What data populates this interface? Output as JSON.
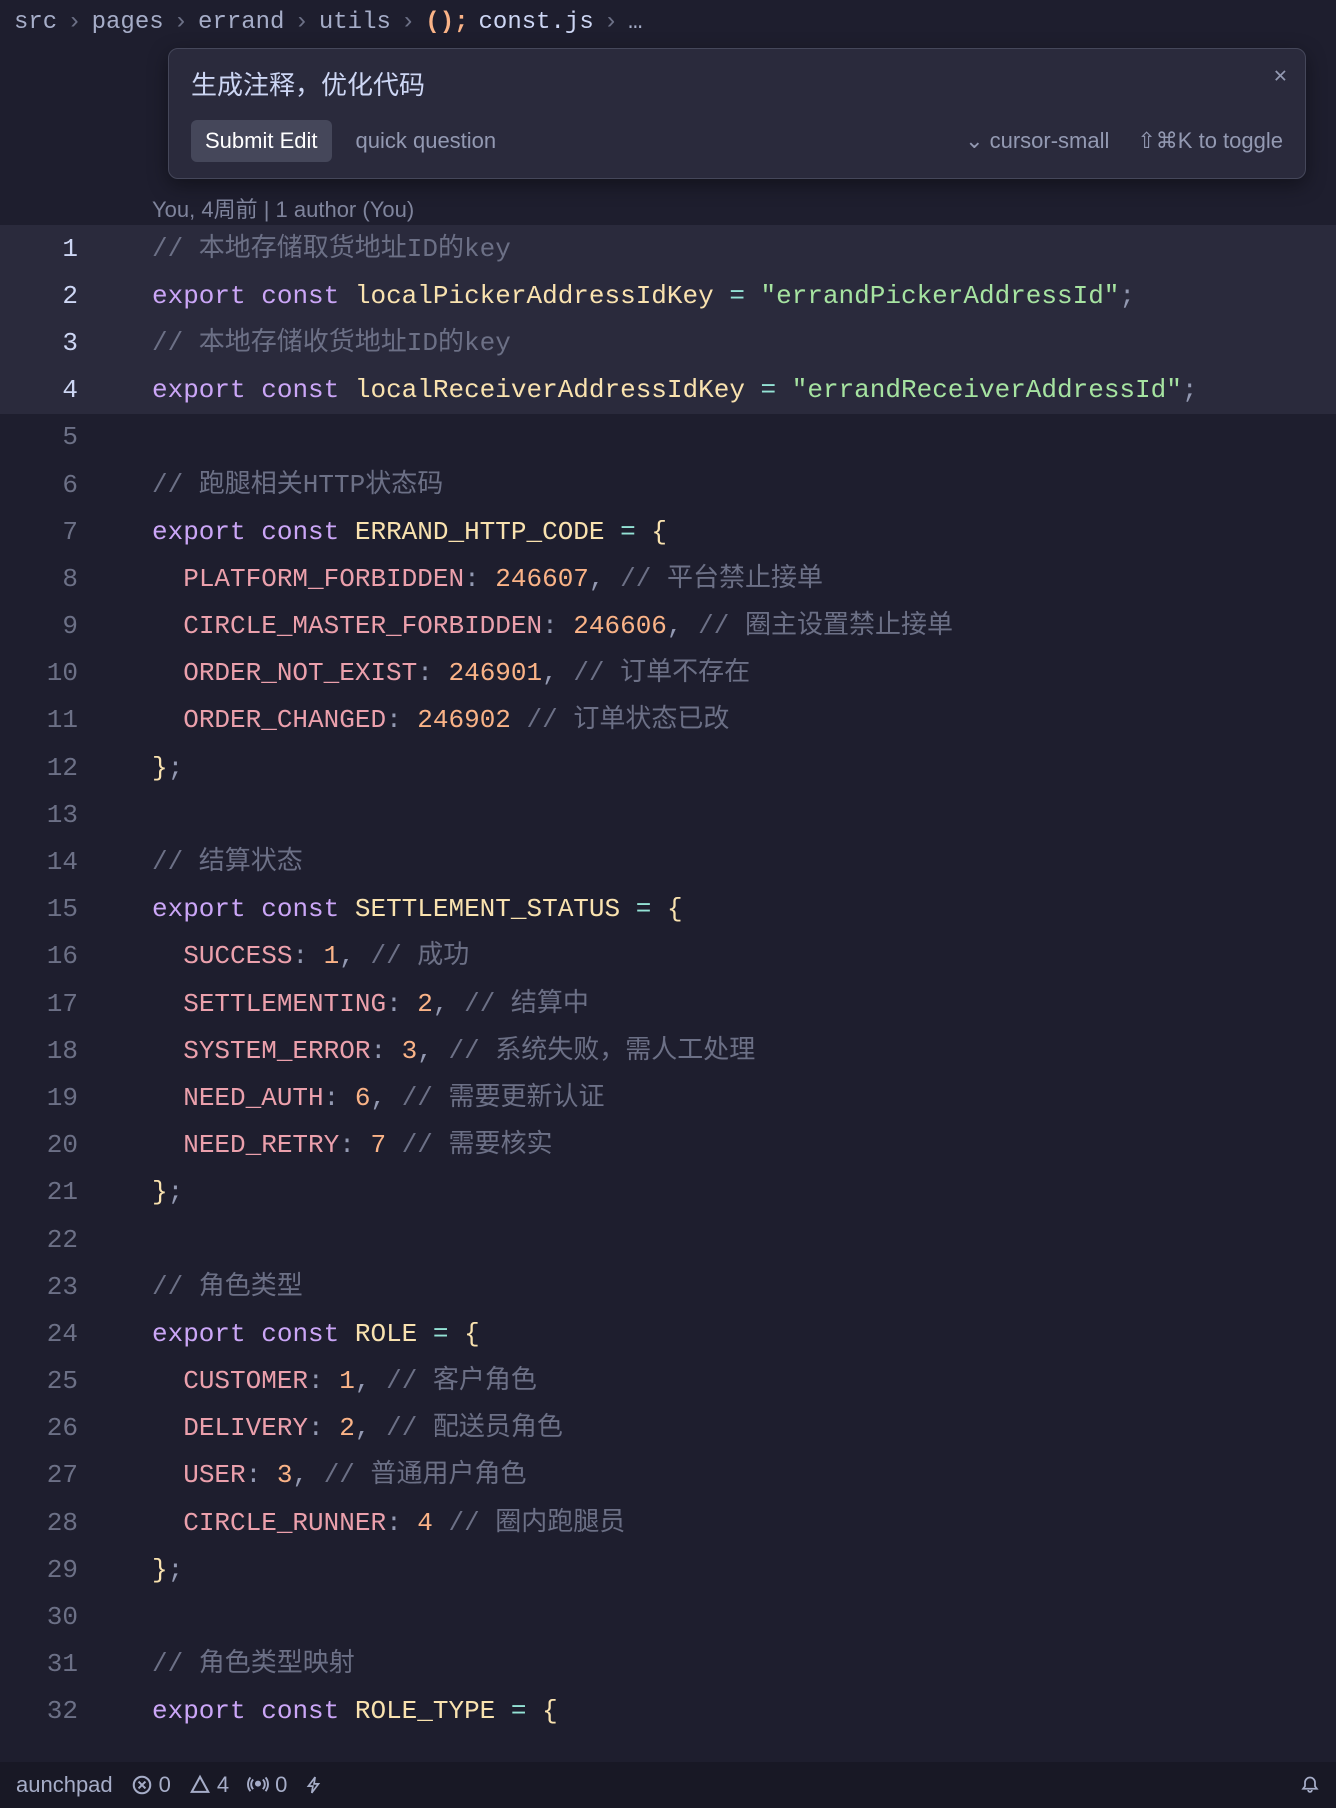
{
  "breadcrumb": {
    "parts": [
      "src",
      "pages",
      "errand",
      "utils"
    ],
    "icon": "();",
    "filename": "const.js",
    "trail": "…"
  },
  "popup": {
    "title": "生成注释，优化代码",
    "submit_label": "Submit Edit",
    "quick_label": "quick question",
    "model_label": "cursor-small",
    "toggle_label": "⇧⌘K to toggle"
  },
  "blame": "You, 4周前 | 1 author (You)",
  "code_lines": [
    {
      "n": 1,
      "hl": true,
      "tokens": [
        [
          "cm",
          "// 本地存储取货地址ID的key"
        ]
      ]
    },
    {
      "n": 2,
      "hl": true,
      "tokens": [
        [
          "kw",
          "export"
        ],
        [
          "sp",
          " "
        ],
        [
          "kw2",
          "const"
        ],
        [
          "sp",
          " "
        ],
        [
          "var",
          "localPickerAddressIdKey"
        ],
        [
          "sp",
          " "
        ],
        [
          "op",
          "="
        ],
        [
          "sp",
          " "
        ],
        [
          "str",
          "\"errandPickerAddressId\""
        ],
        [
          "punc",
          ";"
        ]
      ]
    },
    {
      "n": 3,
      "hl": true,
      "tokens": [
        [
          "cm",
          "// 本地存储收货地址ID的key"
        ]
      ]
    },
    {
      "n": 4,
      "hl": true,
      "tokens": [
        [
          "kw",
          "export"
        ],
        [
          "sp",
          " "
        ],
        [
          "kw2",
          "const"
        ],
        [
          "sp",
          " "
        ],
        [
          "var",
          "localReceiverAddressIdKey"
        ],
        [
          "sp",
          " "
        ],
        [
          "op",
          "="
        ],
        [
          "sp",
          " "
        ],
        [
          "str",
          "\"errandReceiverAddressId\""
        ],
        [
          "punc",
          ";"
        ]
      ]
    },
    {
      "n": 5,
      "tokens": []
    },
    {
      "n": 6,
      "tokens": [
        [
          "cm",
          "// 跑腿相关HTTP状态码"
        ]
      ]
    },
    {
      "n": 7,
      "tokens": [
        [
          "kw",
          "export"
        ],
        [
          "sp",
          " "
        ],
        [
          "kw2",
          "const"
        ],
        [
          "sp",
          " "
        ],
        [
          "var",
          "ERRAND_HTTP_CODE"
        ],
        [
          "sp",
          " "
        ],
        [
          "op",
          "="
        ],
        [
          "sp",
          " "
        ],
        [
          "punc2",
          "{"
        ]
      ]
    },
    {
      "n": 8,
      "tokens": [
        [
          "sp",
          "  "
        ],
        [
          "prop",
          "PLATFORM_FORBIDDEN"
        ],
        [
          "punc",
          ":"
        ],
        [
          "sp",
          " "
        ],
        [
          "num",
          "246607"
        ],
        [
          "punc",
          ","
        ],
        [
          "sp",
          " "
        ],
        [
          "cm",
          "// 平台禁止接单"
        ]
      ]
    },
    {
      "n": 9,
      "tokens": [
        [
          "sp",
          "  "
        ],
        [
          "prop",
          "CIRCLE_MASTER_FORBIDDEN"
        ],
        [
          "punc",
          ":"
        ],
        [
          "sp",
          " "
        ],
        [
          "num",
          "246606"
        ],
        [
          "punc",
          ","
        ],
        [
          "sp",
          " "
        ],
        [
          "cm",
          "// 圈主设置禁止接单"
        ]
      ]
    },
    {
      "n": 10,
      "tokens": [
        [
          "sp",
          "  "
        ],
        [
          "prop",
          "ORDER_NOT_EXIST"
        ],
        [
          "punc",
          ":"
        ],
        [
          "sp",
          " "
        ],
        [
          "num",
          "246901"
        ],
        [
          "punc",
          ","
        ],
        [
          "sp",
          " "
        ],
        [
          "cm",
          "// 订单不存在"
        ]
      ]
    },
    {
      "n": 11,
      "tokens": [
        [
          "sp",
          "  "
        ],
        [
          "prop",
          "ORDER_CHANGED"
        ],
        [
          "punc",
          ":"
        ],
        [
          "sp",
          " "
        ],
        [
          "num",
          "246902"
        ],
        [
          "sp",
          " "
        ],
        [
          "cm",
          "// 订单状态已改"
        ]
      ]
    },
    {
      "n": 12,
      "tokens": [
        [
          "punc2",
          "}"
        ],
        [
          "punc",
          ";"
        ]
      ]
    },
    {
      "n": 13,
      "tokens": []
    },
    {
      "n": 14,
      "tokens": [
        [
          "cm",
          "// 结算状态"
        ]
      ]
    },
    {
      "n": 15,
      "tokens": [
        [
          "kw",
          "export"
        ],
        [
          "sp",
          " "
        ],
        [
          "kw2",
          "const"
        ],
        [
          "sp",
          " "
        ],
        [
          "var",
          "SETTLEMENT_STATUS"
        ],
        [
          "sp",
          " "
        ],
        [
          "op",
          "="
        ],
        [
          "sp",
          " "
        ],
        [
          "punc2",
          "{"
        ]
      ]
    },
    {
      "n": 16,
      "tokens": [
        [
          "sp",
          "  "
        ],
        [
          "prop",
          "SUCCESS"
        ],
        [
          "punc",
          ":"
        ],
        [
          "sp",
          " "
        ],
        [
          "num",
          "1"
        ],
        [
          "punc",
          ","
        ],
        [
          "sp",
          " "
        ],
        [
          "cm",
          "// 成功"
        ]
      ]
    },
    {
      "n": 17,
      "tokens": [
        [
          "sp",
          "  "
        ],
        [
          "prop",
          "SETTLEMENTING"
        ],
        [
          "punc",
          ":"
        ],
        [
          "sp",
          " "
        ],
        [
          "num",
          "2"
        ],
        [
          "punc",
          ","
        ],
        [
          "sp",
          " "
        ],
        [
          "cm",
          "// 结算中"
        ]
      ]
    },
    {
      "n": 18,
      "tokens": [
        [
          "sp",
          "  "
        ],
        [
          "prop",
          "SYSTEM_ERROR"
        ],
        [
          "punc",
          ":"
        ],
        [
          "sp",
          " "
        ],
        [
          "num",
          "3"
        ],
        [
          "punc",
          ","
        ],
        [
          "sp",
          " "
        ],
        [
          "cm",
          "// 系统失败，需人工处理"
        ]
      ]
    },
    {
      "n": 19,
      "tokens": [
        [
          "sp",
          "  "
        ],
        [
          "prop",
          "NEED_AUTH"
        ],
        [
          "punc",
          ":"
        ],
        [
          "sp",
          " "
        ],
        [
          "num",
          "6"
        ],
        [
          "punc",
          ","
        ],
        [
          "sp",
          " "
        ],
        [
          "cm",
          "// 需要更新认证"
        ]
      ]
    },
    {
      "n": 20,
      "tokens": [
        [
          "sp",
          "  "
        ],
        [
          "prop",
          "NEED_RETRY"
        ],
        [
          "punc",
          ":"
        ],
        [
          "sp",
          " "
        ],
        [
          "num",
          "7"
        ],
        [
          "sp",
          " "
        ],
        [
          "cm",
          "// 需要核实"
        ]
      ]
    },
    {
      "n": 21,
      "tokens": [
        [
          "punc2",
          "}"
        ],
        [
          "punc",
          ";"
        ]
      ]
    },
    {
      "n": 22,
      "tokens": []
    },
    {
      "n": 23,
      "tokens": [
        [
          "cm",
          "// 角色类型"
        ]
      ]
    },
    {
      "n": 24,
      "tokens": [
        [
          "kw",
          "export"
        ],
        [
          "sp",
          " "
        ],
        [
          "kw2",
          "const"
        ],
        [
          "sp",
          " "
        ],
        [
          "var",
          "ROLE"
        ],
        [
          "sp",
          " "
        ],
        [
          "op",
          "="
        ],
        [
          "sp",
          " "
        ],
        [
          "punc2",
          "{"
        ]
      ]
    },
    {
      "n": 25,
      "tokens": [
        [
          "sp",
          "  "
        ],
        [
          "prop",
          "CUSTOMER"
        ],
        [
          "punc",
          ":"
        ],
        [
          "sp",
          " "
        ],
        [
          "num",
          "1"
        ],
        [
          "punc",
          ","
        ],
        [
          "sp",
          " "
        ],
        [
          "cm",
          "// 客户角色"
        ]
      ]
    },
    {
      "n": 26,
      "tokens": [
        [
          "sp",
          "  "
        ],
        [
          "prop",
          "DELIVERY"
        ],
        [
          "punc",
          ":"
        ],
        [
          "sp",
          " "
        ],
        [
          "num",
          "2"
        ],
        [
          "punc",
          ","
        ],
        [
          "sp",
          " "
        ],
        [
          "cm",
          "// 配送员角色"
        ]
      ]
    },
    {
      "n": 27,
      "tokens": [
        [
          "sp",
          "  "
        ],
        [
          "prop",
          "USER"
        ],
        [
          "punc",
          ":"
        ],
        [
          "sp",
          " "
        ],
        [
          "num",
          "3"
        ],
        [
          "punc",
          ","
        ],
        [
          "sp",
          " "
        ],
        [
          "cm",
          "// 普通用户角色"
        ]
      ]
    },
    {
      "n": 28,
      "tokens": [
        [
          "sp",
          "  "
        ],
        [
          "prop",
          "CIRCLE_RUNNER"
        ],
        [
          "punc",
          ":"
        ],
        [
          "sp",
          " "
        ],
        [
          "num",
          "4"
        ],
        [
          "sp",
          " "
        ],
        [
          "cm",
          "// 圈内跑腿员"
        ]
      ]
    },
    {
      "n": 29,
      "tokens": [
        [
          "punc2",
          "}"
        ],
        [
          "punc",
          ";"
        ]
      ]
    },
    {
      "n": 30,
      "tokens": []
    },
    {
      "n": 31,
      "tokens": [
        [
          "cm",
          "// 角色类型映射"
        ]
      ]
    },
    {
      "n": 32,
      "tokens": [
        [
          "kw",
          "export"
        ],
        [
          "sp",
          " "
        ],
        [
          "kw2",
          "const"
        ],
        [
          "sp",
          " "
        ],
        [
          "var",
          "ROLE_TYPE"
        ],
        [
          "sp",
          " "
        ],
        [
          "op",
          "="
        ],
        [
          "sp",
          " "
        ],
        [
          "punc2",
          "{"
        ]
      ]
    }
  ],
  "status": {
    "launchpad": "aunchpad",
    "errors": "0",
    "warnings": "4",
    "ports": "0"
  }
}
